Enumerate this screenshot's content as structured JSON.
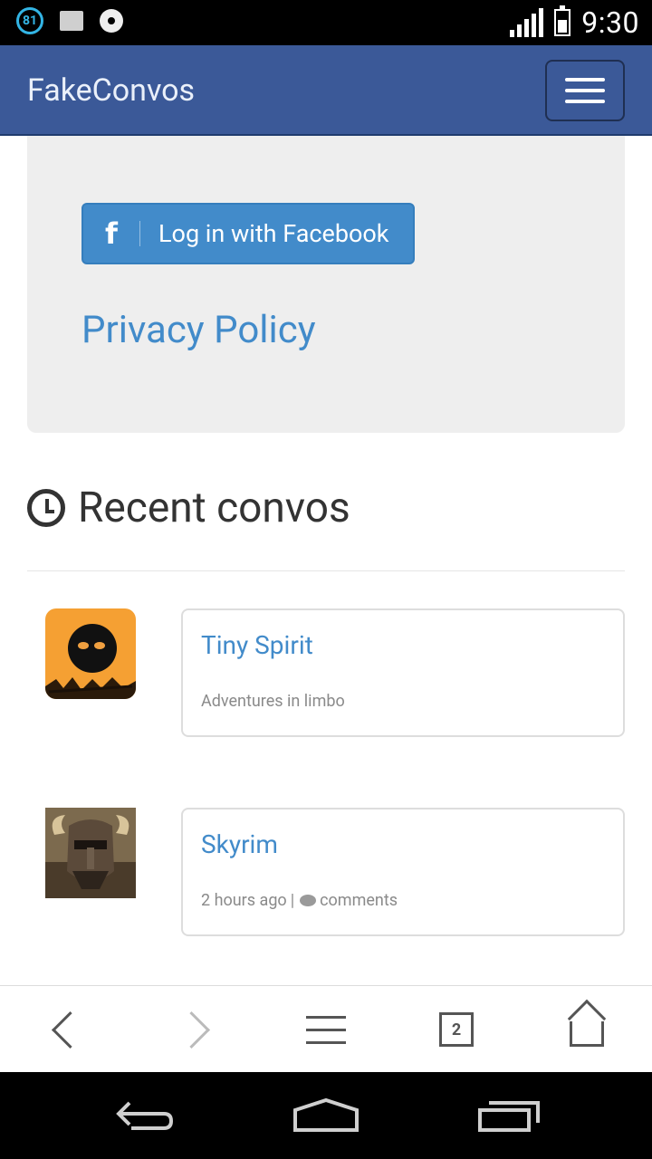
{
  "status_bar": {
    "notification_count": "81",
    "time": "9:30",
    "icons": [
      "badge-icon",
      "picture-icon",
      "disc-icon",
      "signal-icon",
      "battery-charging-icon"
    ]
  },
  "navbar": {
    "brand": "FakeConvos",
    "toggle_icon": "hamburger-icon"
  },
  "login_panel": {
    "facebook_icon": "f",
    "facebook_button": "Log in with Facebook",
    "privacy_link": "Privacy Policy"
  },
  "recent": {
    "heading": "Recent convos",
    "heading_icon": "clock-icon",
    "items": [
      {
        "title": "Tiny Spirit",
        "meta": "Adventures in limbo",
        "avatar_icon": "tiny-spirit-avatar"
      },
      {
        "title": "Skyrim",
        "time": "2 hours ago",
        "separator": "|",
        "comments": "comments",
        "avatar_icon": "skyrim-avatar"
      }
    ]
  },
  "browser_bar": {
    "tab_count": "2",
    "icons": [
      "back-icon",
      "forward-icon",
      "menu-icon",
      "tabs-icon",
      "home-icon"
    ]
  },
  "android_nav": {
    "icons": [
      "android-back-icon",
      "android-home-icon",
      "android-recents-icon"
    ]
  },
  "colors": {
    "navbar": "#3b5998",
    "link": "#428bca",
    "facebook_button": "#428bca",
    "panel_bg": "#eeeeee"
  }
}
